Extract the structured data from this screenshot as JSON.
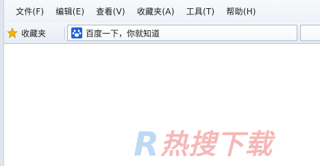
{
  "menubar": {
    "items": [
      {
        "label": "文件(F)"
      },
      {
        "label": "编辑(E)"
      },
      {
        "label": "查看(V)"
      },
      {
        "label": "收藏夹(A)"
      },
      {
        "label": "工具(T)"
      },
      {
        "label": "帮助(H)"
      }
    ]
  },
  "favorites_bar": {
    "favorites_button": {
      "label": "收藏夹",
      "icon": "star-icon"
    },
    "tab": {
      "title": "百度一下，你就知道",
      "icon": "baidu-paw-icon"
    }
  },
  "watermark": {
    "letter": "R",
    "text": "热搜下载"
  },
  "colors": {
    "accent_blue": "#1a63d8",
    "star_yellow": "#f5b800",
    "watermark_blue": "#a9cdf0",
    "watermark_red": "#f2a1a1"
  }
}
